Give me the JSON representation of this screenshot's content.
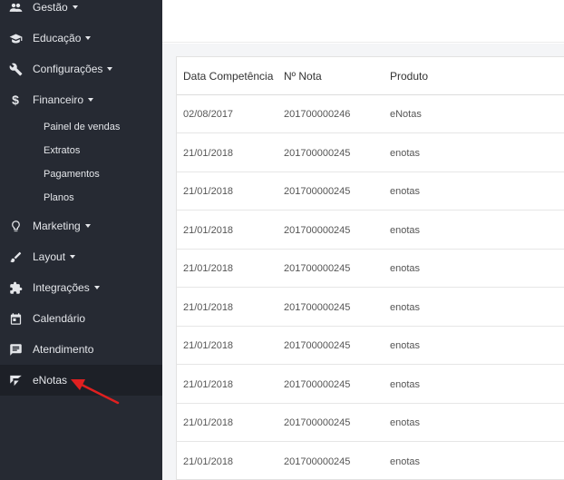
{
  "sidebar": {
    "items": [
      {
        "label": "Gestão",
        "icon": "users-icon",
        "has_caret": true
      },
      {
        "label": "Educação",
        "icon": "graduation-cap-icon",
        "has_caret": true
      },
      {
        "label": "Configurações",
        "icon": "wrench-icon",
        "has_caret": true
      },
      {
        "label": "Financeiro",
        "icon": "dollar-icon",
        "has_caret": true
      },
      {
        "label": "Marketing",
        "icon": "lightbulb-icon",
        "has_caret": true
      },
      {
        "label": "Layout",
        "icon": "brush-icon",
        "has_caret": true
      },
      {
        "label": "Integrações",
        "icon": "puzzle-icon",
        "has_caret": true
      },
      {
        "label": "Calendário",
        "icon": "calendar-icon",
        "has_caret": false
      },
      {
        "label": "Atendimento",
        "icon": "chat-icon",
        "has_caret": false
      },
      {
        "label": "eNotas",
        "icon": "enotas-logo-icon",
        "has_caret": false
      }
    ],
    "financeiro_sub": [
      "Painel de vendas",
      "Extratos",
      "Pagamentos",
      "Planos"
    ]
  },
  "table": {
    "headers": [
      "Data Competência",
      "Nº Nota",
      "Produto"
    ],
    "rows": [
      [
        "02/08/2017",
        "201700000246",
        "eNotas"
      ],
      [
        "21/01/2018",
        "201700000245",
        "enotas"
      ],
      [
        "21/01/2018",
        "201700000245",
        "enotas"
      ],
      [
        "21/01/2018",
        "201700000245",
        "enotas"
      ],
      [
        "21/01/2018",
        "201700000245",
        "enotas"
      ],
      [
        "21/01/2018",
        "201700000245",
        "enotas"
      ],
      [
        "21/01/2018",
        "201700000245",
        "enotas"
      ],
      [
        "21/01/2018",
        "201700000245",
        "enotas"
      ],
      [
        "21/01/2018",
        "201700000245",
        "enotas"
      ],
      [
        "21/01/2018",
        "201700000245",
        "enotas"
      ]
    ]
  },
  "colors": {
    "sidebar_bg": "#262a33",
    "annotation_arrow": "#e02020"
  }
}
